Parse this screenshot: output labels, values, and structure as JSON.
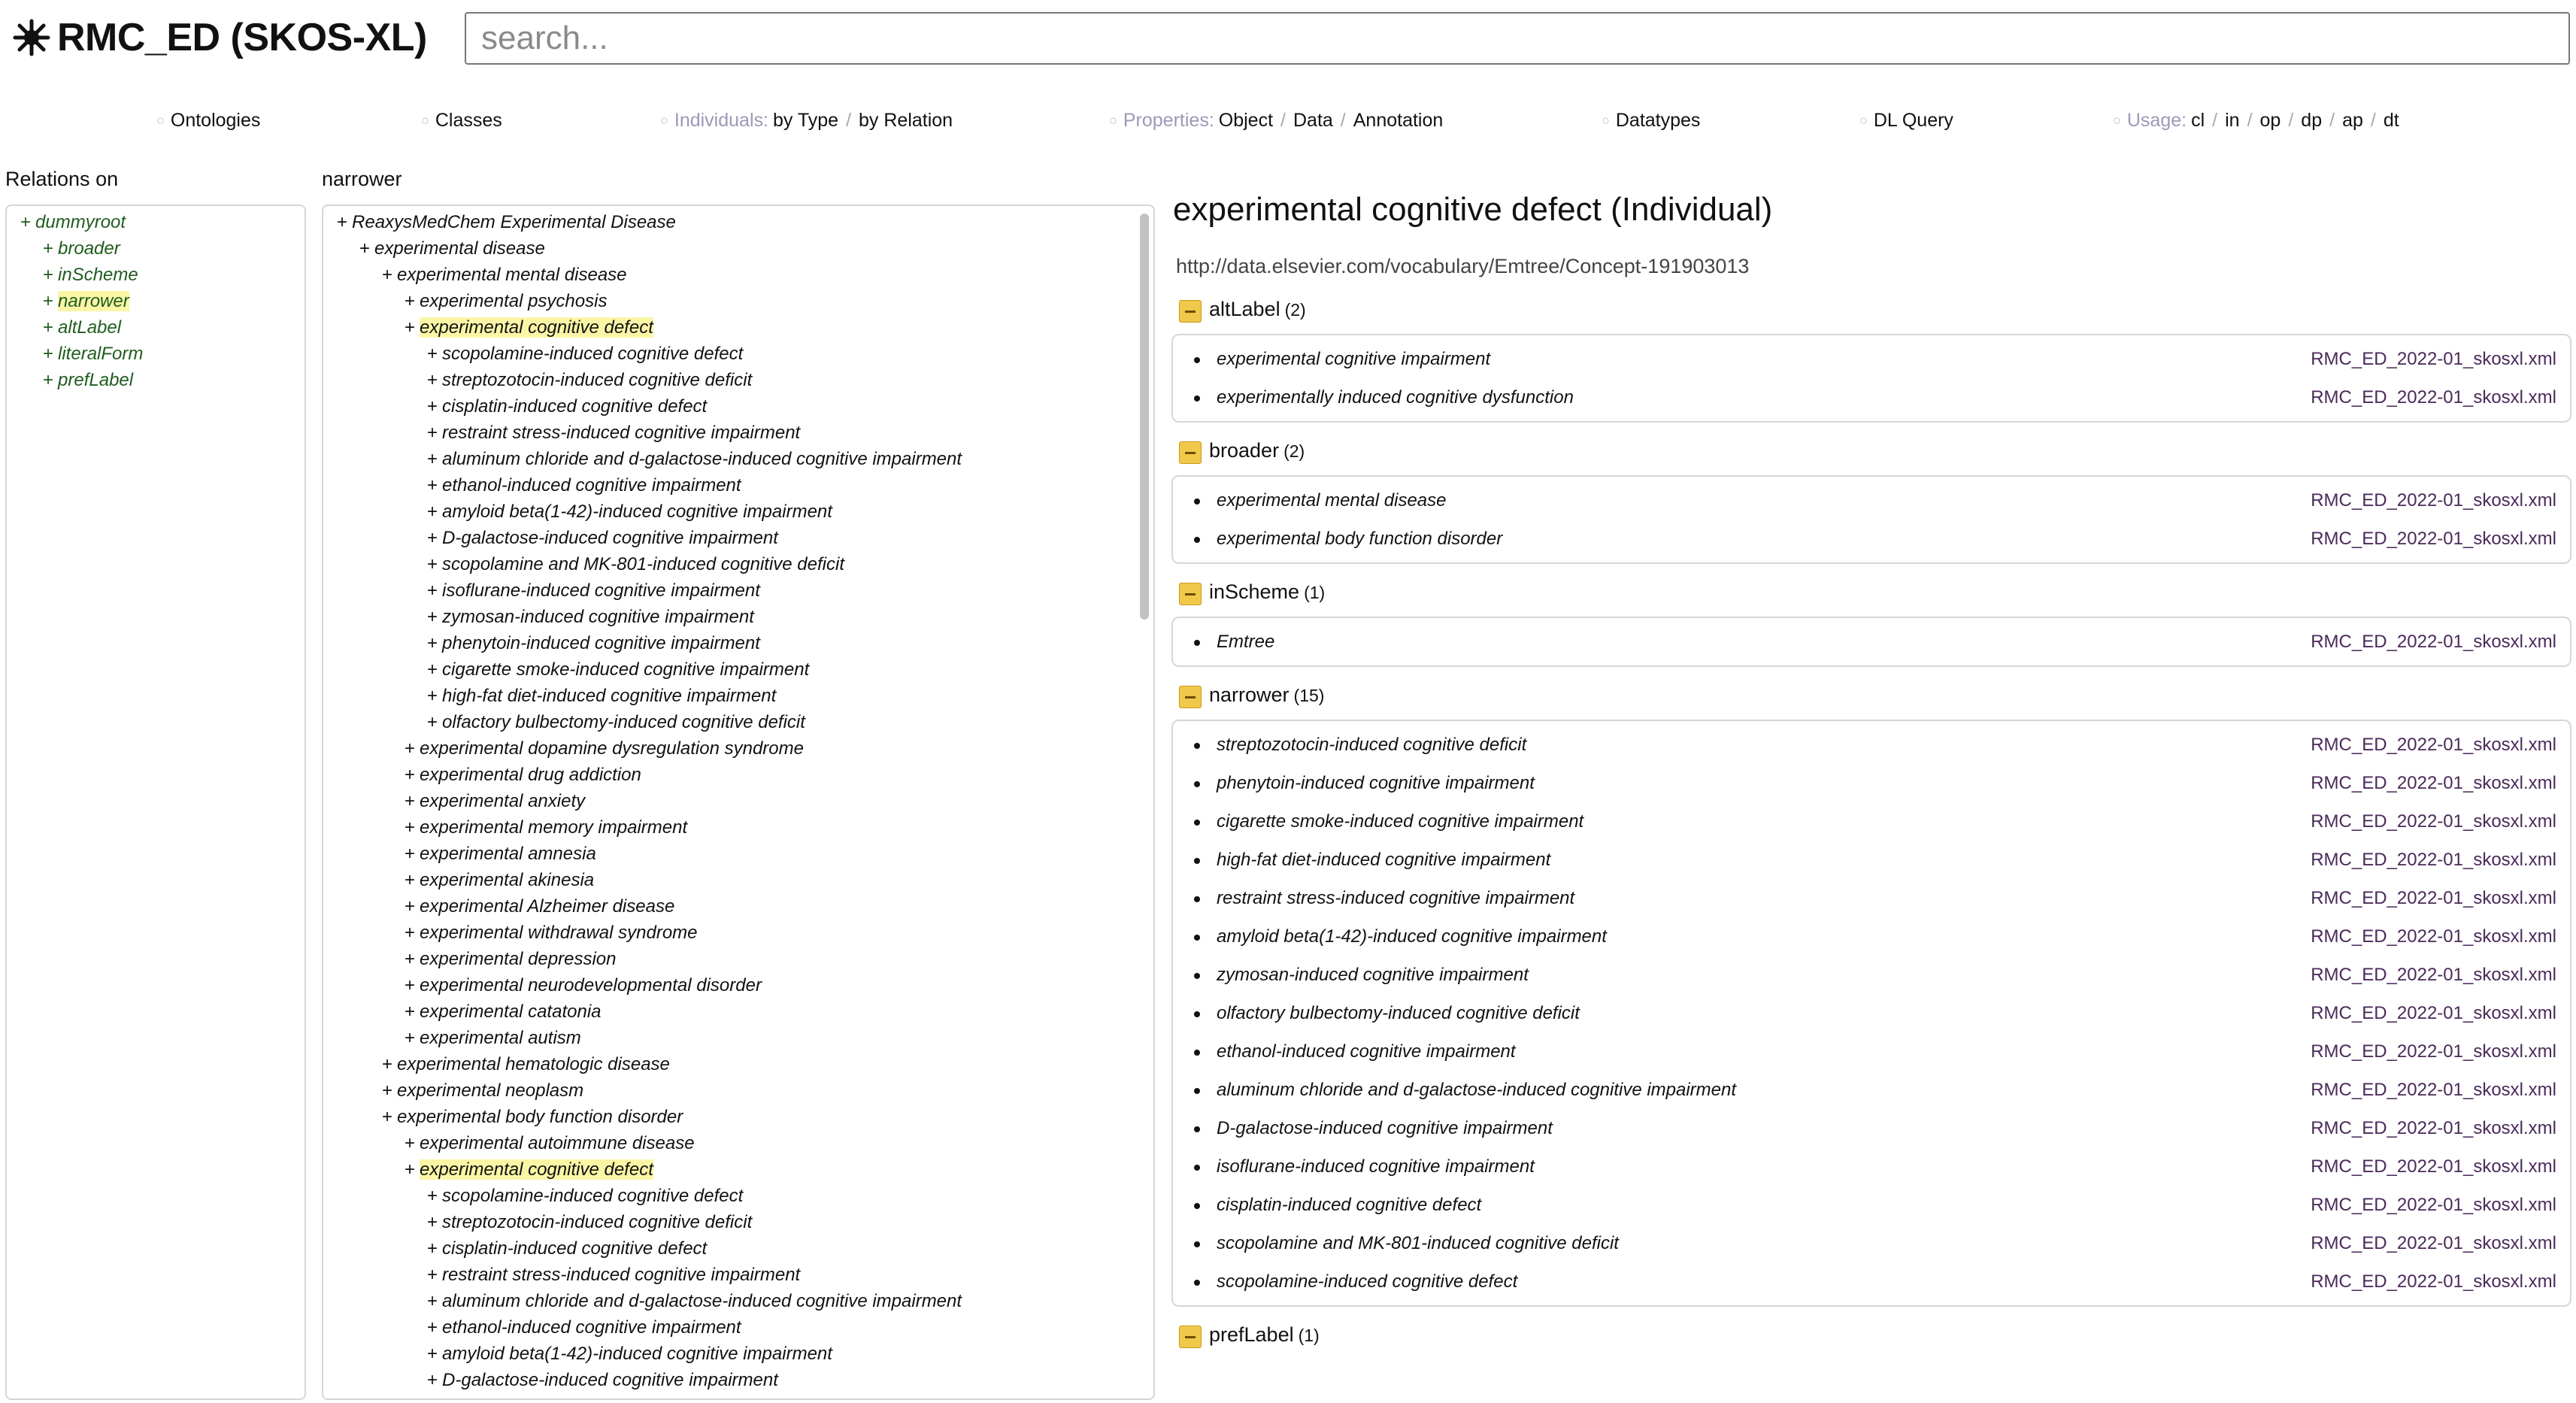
{
  "app": {
    "title": "RMC_ED (SKOS-XL)",
    "logo_icon": "sun-burst-icon"
  },
  "search": {
    "placeholder": "search..."
  },
  "nav": {
    "ontologies": "Ontologies",
    "classes": "Classes",
    "individuals": {
      "label": "Individuals:",
      "by_type": "by Type",
      "by_relation": "by Relation"
    },
    "properties": {
      "label": "Properties:",
      "object": "Object",
      "data": "Data",
      "annotation": "Annotation"
    },
    "datatypes": "Datatypes",
    "dl_query": "DL Query",
    "usage": {
      "label": "Usage:",
      "cl": "cl",
      "in": "in",
      "op": "op",
      "dp": "dp",
      "ap": "ap",
      "dt": "dt"
    },
    "separator": "/"
  },
  "relations": {
    "title": "Relations on",
    "items": [
      {
        "label": "dummyroot",
        "level": 0,
        "highlighted": false
      },
      {
        "label": "broader",
        "level": 1,
        "highlighted": false
      },
      {
        "label": "inScheme",
        "level": 1,
        "highlighted": false
      },
      {
        "label": "narrower",
        "level": 1,
        "highlighted": true
      },
      {
        "label": "altLabel",
        "level": 1,
        "highlighted": false
      },
      {
        "label": "literalForm",
        "level": 1,
        "highlighted": false
      },
      {
        "label": "prefLabel",
        "level": 1,
        "highlighted": false
      }
    ]
  },
  "tree": {
    "title": "narrower",
    "items": [
      {
        "label": "ReaxysMedChem Experimental Disease",
        "level": 0,
        "highlighted": false
      },
      {
        "label": "experimental disease",
        "level": 1,
        "highlighted": false
      },
      {
        "label": "experimental mental disease",
        "level": 2,
        "highlighted": false
      },
      {
        "label": "experimental psychosis",
        "level": 3,
        "highlighted": false
      },
      {
        "label": "experimental cognitive defect",
        "level": 3,
        "highlighted": true
      },
      {
        "label": "scopolamine-induced cognitive defect",
        "level": 4,
        "highlighted": false
      },
      {
        "label": "streptozotocin-induced cognitive deficit",
        "level": 4,
        "highlighted": false
      },
      {
        "label": "cisplatin-induced cognitive defect",
        "level": 4,
        "highlighted": false
      },
      {
        "label": "restraint stress-induced cognitive impairment",
        "level": 4,
        "highlighted": false
      },
      {
        "label": "aluminum chloride and d-galactose-induced cognitive impairment",
        "level": 4,
        "highlighted": false
      },
      {
        "label": "ethanol-induced cognitive impairment",
        "level": 4,
        "highlighted": false
      },
      {
        "label": "amyloid beta(1-42)-induced cognitive impairment",
        "level": 4,
        "highlighted": false
      },
      {
        "label": "D-galactose-induced cognitive impairment",
        "level": 4,
        "highlighted": false
      },
      {
        "label": "scopolamine and MK-801-induced cognitive deficit",
        "level": 4,
        "highlighted": false
      },
      {
        "label": "isoflurane-induced cognitive impairment",
        "level": 4,
        "highlighted": false
      },
      {
        "label": "zymosan-induced cognitive impairment",
        "level": 4,
        "highlighted": false
      },
      {
        "label": "phenytoin-induced cognitive impairment",
        "level": 4,
        "highlighted": false
      },
      {
        "label": "cigarette smoke-induced cognitive impairment",
        "level": 4,
        "highlighted": false
      },
      {
        "label": "high-fat diet-induced cognitive impairment",
        "level": 4,
        "highlighted": false
      },
      {
        "label": "olfactory bulbectomy-induced cognitive deficit",
        "level": 4,
        "highlighted": false
      },
      {
        "label": "experimental dopamine dysregulation syndrome",
        "level": 3,
        "highlighted": false
      },
      {
        "label": "experimental drug addiction",
        "level": 3,
        "highlighted": false
      },
      {
        "label": "experimental anxiety",
        "level": 3,
        "highlighted": false
      },
      {
        "label": "experimental memory impairment",
        "level": 3,
        "highlighted": false
      },
      {
        "label": "experimental amnesia",
        "level": 3,
        "highlighted": false
      },
      {
        "label": "experimental akinesia",
        "level": 3,
        "highlighted": false
      },
      {
        "label": "experimental Alzheimer disease",
        "level": 3,
        "highlighted": false
      },
      {
        "label": "experimental withdrawal syndrome",
        "level": 3,
        "highlighted": false
      },
      {
        "label": "experimental depression",
        "level": 3,
        "highlighted": false
      },
      {
        "label": "experimental neurodevelopmental disorder",
        "level": 3,
        "highlighted": false
      },
      {
        "label": "experimental catatonia",
        "level": 3,
        "highlighted": false
      },
      {
        "label": "experimental autism",
        "level": 3,
        "highlighted": false
      },
      {
        "label": "experimental hematologic disease",
        "level": 2,
        "highlighted": false
      },
      {
        "label": "experimental neoplasm",
        "level": 2,
        "highlighted": false
      },
      {
        "label": "experimental body function disorder",
        "level": 2,
        "highlighted": false
      },
      {
        "label": "experimental autoimmune disease",
        "level": 3,
        "highlighted": false
      },
      {
        "label": "experimental cognitive defect",
        "level": 3,
        "highlighted": true
      },
      {
        "label": "scopolamine-induced cognitive defect",
        "level": 4,
        "highlighted": false
      },
      {
        "label": "streptozotocin-induced cognitive deficit",
        "level": 4,
        "highlighted": false
      },
      {
        "label": "cisplatin-induced cognitive defect",
        "level": 4,
        "highlighted": false
      },
      {
        "label": "restraint stress-induced cognitive impairment",
        "level": 4,
        "highlighted": false
      },
      {
        "label": "aluminum chloride and d-galactose-induced cognitive impairment",
        "level": 4,
        "highlighted": false
      },
      {
        "label": "ethanol-induced cognitive impairment",
        "level": 4,
        "highlighted": false
      },
      {
        "label": "amyloid beta(1-42)-induced cognitive impairment",
        "level": 4,
        "highlighted": false
      },
      {
        "label": "D-galactose-induced cognitive impairment",
        "level": 4,
        "highlighted": false
      }
    ]
  },
  "detail": {
    "title": "experimental cognitive defect (Individual)",
    "uri": "http://data.elsevier.com/vocabulary/Emtree/Concept-191903013",
    "sections": [
      {
        "name": "altLabel",
        "count": "(2)",
        "rows": [
          {
            "label": "experimental cognitive impairment",
            "source": "RMC_ED_2022-01_skosxl.xml"
          },
          {
            "label": "experimentally induced cognitive dysfunction",
            "source": "RMC_ED_2022-01_skosxl.xml"
          }
        ]
      },
      {
        "name": "broader",
        "count": "(2)",
        "rows": [
          {
            "label": "experimental mental disease",
            "source": "RMC_ED_2022-01_skosxl.xml"
          },
          {
            "label": "experimental body function disorder",
            "source": "RMC_ED_2022-01_skosxl.xml"
          }
        ]
      },
      {
        "name": "inScheme",
        "count": "(1)",
        "rows": [
          {
            "label": "Emtree",
            "source": "RMC_ED_2022-01_skosxl.xml"
          }
        ]
      },
      {
        "name": "narrower",
        "count": "(15)",
        "rows": [
          {
            "label": "streptozotocin-induced cognitive deficit",
            "source": "RMC_ED_2022-01_skosxl.xml"
          },
          {
            "label": "phenytoin-induced cognitive impairment",
            "source": "RMC_ED_2022-01_skosxl.xml"
          },
          {
            "label": "cigarette smoke-induced cognitive impairment",
            "source": "RMC_ED_2022-01_skosxl.xml"
          },
          {
            "label": "high-fat diet-induced cognitive impairment",
            "source": "RMC_ED_2022-01_skosxl.xml"
          },
          {
            "label": "restraint stress-induced cognitive impairment",
            "source": "RMC_ED_2022-01_skosxl.xml"
          },
          {
            "label": "amyloid beta(1-42)-induced cognitive impairment",
            "source": "RMC_ED_2022-01_skosxl.xml"
          },
          {
            "label": "zymosan-induced cognitive impairment",
            "source": "RMC_ED_2022-01_skosxl.xml"
          },
          {
            "label": "olfactory bulbectomy-induced cognitive deficit",
            "source": "RMC_ED_2022-01_skosxl.xml"
          },
          {
            "label": "ethanol-induced cognitive impairment",
            "source": "RMC_ED_2022-01_skosxl.xml"
          },
          {
            "label": "aluminum chloride and d-galactose-induced cognitive impairment",
            "source": "RMC_ED_2022-01_skosxl.xml"
          },
          {
            "label": "D-galactose-induced cognitive impairment",
            "source": "RMC_ED_2022-01_skosxl.xml"
          },
          {
            "label": "isoflurane-induced cognitive impairment",
            "source": "RMC_ED_2022-01_skosxl.xml"
          },
          {
            "label": "cisplatin-induced cognitive defect",
            "source": "RMC_ED_2022-01_skosxl.xml"
          },
          {
            "label": "scopolamine and MK-801-induced cognitive deficit",
            "source": "RMC_ED_2022-01_skosxl.xml"
          },
          {
            "label": "scopolamine-induced cognitive defect",
            "source": "RMC_ED_2022-01_skosxl.xml"
          }
        ]
      },
      {
        "name": "prefLabel",
        "count": "(1)",
        "rows": []
      }
    ]
  },
  "colors": {
    "highlight": "#fbf6a6",
    "relation_text": "#1f5c1f",
    "toggle": "#f0c84a",
    "source_link": "#4a2a5a"
  }
}
